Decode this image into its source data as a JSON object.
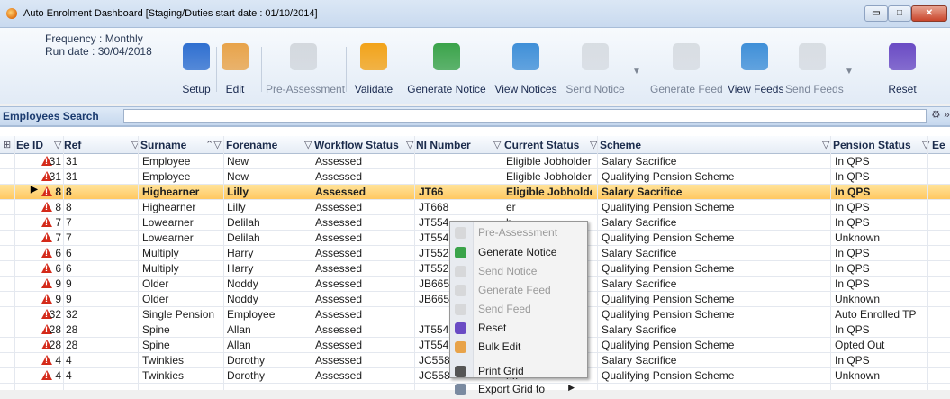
{
  "window": {
    "title": "Auto Enrolment Dashboard [Staging/Duties start date : 01/10/2014]",
    "buttons": {
      "minimize": "▭",
      "maximize": "□",
      "close": "✕"
    }
  },
  "toolbar": {
    "frequency": "Frequency : Monthly",
    "run_date": "Run date : 30/04/2018",
    "buttons": [
      {
        "label": "Setup",
        "icon": "setup-icon",
        "enabled": true,
        "color": "#2f6fd0"
      },
      {
        "label": "Edit",
        "icon": "pencil-icon",
        "enabled": true,
        "color": "#e8a34a"
      },
      {
        "label": "Pre-Assessment",
        "icon": "pre-assessment-icon",
        "enabled": false,
        "color": "#bfc4ca"
      },
      {
        "label": "Validate",
        "icon": "validate-icon",
        "enabled": true,
        "color": "#f2a31a"
      },
      {
        "label": "Generate Notice",
        "icon": "generate-notice-icon",
        "enabled": true,
        "color": "#3aa34a"
      },
      {
        "label": "View Notices",
        "icon": "view-notices-icon",
        "enabled": true,
        "color": "#3f8fd8"
      },
      {
        "label": "Send Notice",
        "icon": "send-notice-icon",
        "enabled": false,
        "color": "#c7ccd2"
      },
      {
        "label": "Generate Feed",
        "icon": "generate-feed-icon",
        "enabled": false,
        "color": "#c7ccd2"
      },
      {
        "label": "View Feeds",
        "icon": "view-feeds-icon",
        "enabled": true,
        "color": "#3f8fd8"
      },
      {
        "label": "Send Feeds",
        "icon": "send-feeds-icon",
        "enabled": false,
        "color": "#c7ccd2"
      },
      {
        "label": "Reset",
        "icon": "reset-icon",
        "enabled": true,
        "color": "#6a4bc4"
      }
    ]
  },
  "search": {
    "label": "Employees Search",
    "value": "",
    "tools": "⚙ »"
  },
  "grid": {
    "columns": [
      {
        "label": "Ee ID"
      },
      {
        "label": "Ref"
      },
      {
        "label": "Surname"
      },
      {
        "label": "Forename"
      },
      {
        "label": "Workflow Status"
      },
      {
        "label": "NI Number"
      },
      {
        "label": "Current Status"
      },
      {
        "label": "Scheme"
      },
      {
        "label": "Pension Status"
      },
      {
        "label": "Ee"
      }
    ],
    "rows": [
      {
        "id": "31",
        "ref": "31",
        "surname": "Employee",
        "forename": "New",
        "workflow": "Assessed",
        "ni": "",
        "status": "Eligible Jobholder",
        "scheme": "Salary Sacrifice",
        "pension": "In QPS",
        "selected": false
      },
      {
        "id": "31",
        "ref": "31",
        "surname": "Employee",
        "forename": "New",
        "workflow": "Assessed",
        "ni": "",
        "status": "Eligible Jobholder",
        "scheme": "Qualifying Pension Scheme",
        "pension": "In QPS",
        "selected": false
      },
      {
        "id": "8",
        "ref": "8",
        "surname": "Highearner",
        "forename": "Lilly",
        "workflow": "Assessed",
        "ni": "JT66",
        "status": "Eligible Jobholder",
        "scheme": "Salary Sacrifice",
        "pension": "In QPS",
        "selected": true
      },
      {
        "id": "8",
        "ref": "8",
        "surname": "Highearner",
        "forename": "Lilly",
        "workflow": "Assessed",
        "ni": "JT668",
        "status": "er",
        "scheme": "Qualifying Pension Scheme",
        "pension": "In QPS",
        "selected": false
      },
      {
        "id": "7",
        "ref": "7",
        "surname": "Lowearner",
        "forename": "Delilah",
        "workflow": "Assessed",
        "ni": "JT554",
        "status": "h..",
        "scheme": "Salary Sacrifice",
        "pension": "In QPS",
        "selected": false
      },
      {
        "id": "7",
        "ref": "7",
        "surname": "Lowearner",
        "forename": "Delilah",
        "workflow": "Assessed",
        "ni": "JT554",
        "status": "h..",
        "scheme": "Qualifying Pension Scheme",
        "pension": "Unknown",
        "selected": false
      },
      {
        "id": "6",
        "ref": "6",
        "surname": "Multiply",
        "forename": "Harry",
        "workflow": "Assessed",
        "ni": "JT552",
        "status": "er",
        "scheme": "Salary Sacrifice",
        "pension": "In QPS",
        "selected": false
      },
      {
        "id": "6",
        "ref": "6",
        "surname": "Multiply",
        "forename": "Harry",
        "workflow": "Assessed",
        "ni": "JT552",
        "status": "er",
        "scheme": "Qualifying Pension Scheme",
        "pension": "In QPS",
        "selected": false
      },
      {
        "id": "9",
        "ref": "9",
        "surname": "Older",
        "forename": "Noddy",
        "workflow": "Assessed",
        "ni": "JB665",
        "status": "r..",
        "scheme": "Salary Sacrifice",
        "pension": "In QPS",
        "selected": false
      },
      {
        "id": "9",
        "ref": "9",
        "surname": "Older",
        "forename": "Noddy",
        "workflow": "Assessed",
        "ni": "JB665",
        "status": "r..",
        "scheme": "Qualifying Pension Scheme",
        "pension": "Unknown",
        "selected": false
      },
      {
        "id": "32",
        "ref": "32",
        "surname": "Single Pension",
        "forename": "Employee",
        "workflow": "Assessed",
        "ni": "",
        "status": "er",
        "scheme": "Qualifying Pension Scheme",
        "pension": "Auto Enrolled TP",
        "selected": false
      },
      {
        "id": "28",
        "ref": "28",
        "surname": "Spine",
        "forename": "Allan",
        "workflow": "Assessed",
        "ni": "JT554",
        "status": "er",
        "scheme": "Salary Sacrifice",
        "pension": "In QPS",
        "selected": false
      },
      {
        "id": "28",
        "ref": "28",
        "surname": "Spine",
        "forename": "Allan",
        "workflow": "Assessed",
        "ni": "JT554",
        "status": "er",
        "scheme": "Qualifying Pension Scheme",
        "pension": "Opted Out",
        "selected": false
      },
      {
        "id": "4",
        "ref": "4",
        "surname": "Twinkies",
        "forename": "Dorothy",
        "workflow": "Assessed",
        "ni": "JC558",
        "status": "h..",
        "scheme": "Salary Sacrifice",
        "pension": "In QPS",
        "selected": false
      },
      {
        "id": "4",
        "ref": "4",
        "surname": "Twinkies",
        "forename": "Dorothy",
        "workflow": "Assessed",
        "ni": "JC558",
        "status": "h..",
        "scheme": "Qualifying Pension Scheme",
        "pension": "Unknown",
        "selected": false
      }
    ]
  },
  "context_menu": {
    "items": [
      {
        "label": "Pre-Assessment",
        "icon": "pre-assessment-icon",
        "enabled": false,
        "color": "#c9c9c9"
      },
      {
        "label": "Generate Notice",
        "icon": "generate-notice-icon",
        "enabled": true,
        "color": "#3aa34a"
      },
      {
        "label": "Send Notice",
        "icon": "send-notice-icon",
        "enabled": false,
        "color": "#c9c9c9"
      },
      {
        "label": "Generate Feed",
        "icon": "generate-feed-icon",
        "enabled": false,
        "color": "#c9c9c9"
      },
      {
        "label": "Send Feed",
        "icon": "send-feed-icon",
        "enabled": false,
        "color": "#c9c9c9"
      },
      {
        "label": "Reset",
        "icon": "reset-icon",
        "enabled": true,
        "color": "#6a4bc4"
      },
      {
        "label": "Bulk Edit",
        "icon": "pencil-icon",
        "enabled": true,
        "color": "#e8a34a"
      },
      {
        "label": "Print Grid",
        "icon": "printer-icon",
        "enabled": true,
        "color": "#555555"
      },
      {
        "label": "Export Grid to",
        "icon": "export-icon",
        "enabled": true,
        "color": "#7a8aa0",
        "submenu": true
      }
    ]
  },
  "colors": {
    "accent": "#ffc861",
    "warning": "#d42a1a",
    "header": "#1b3b6f"
  }
}
